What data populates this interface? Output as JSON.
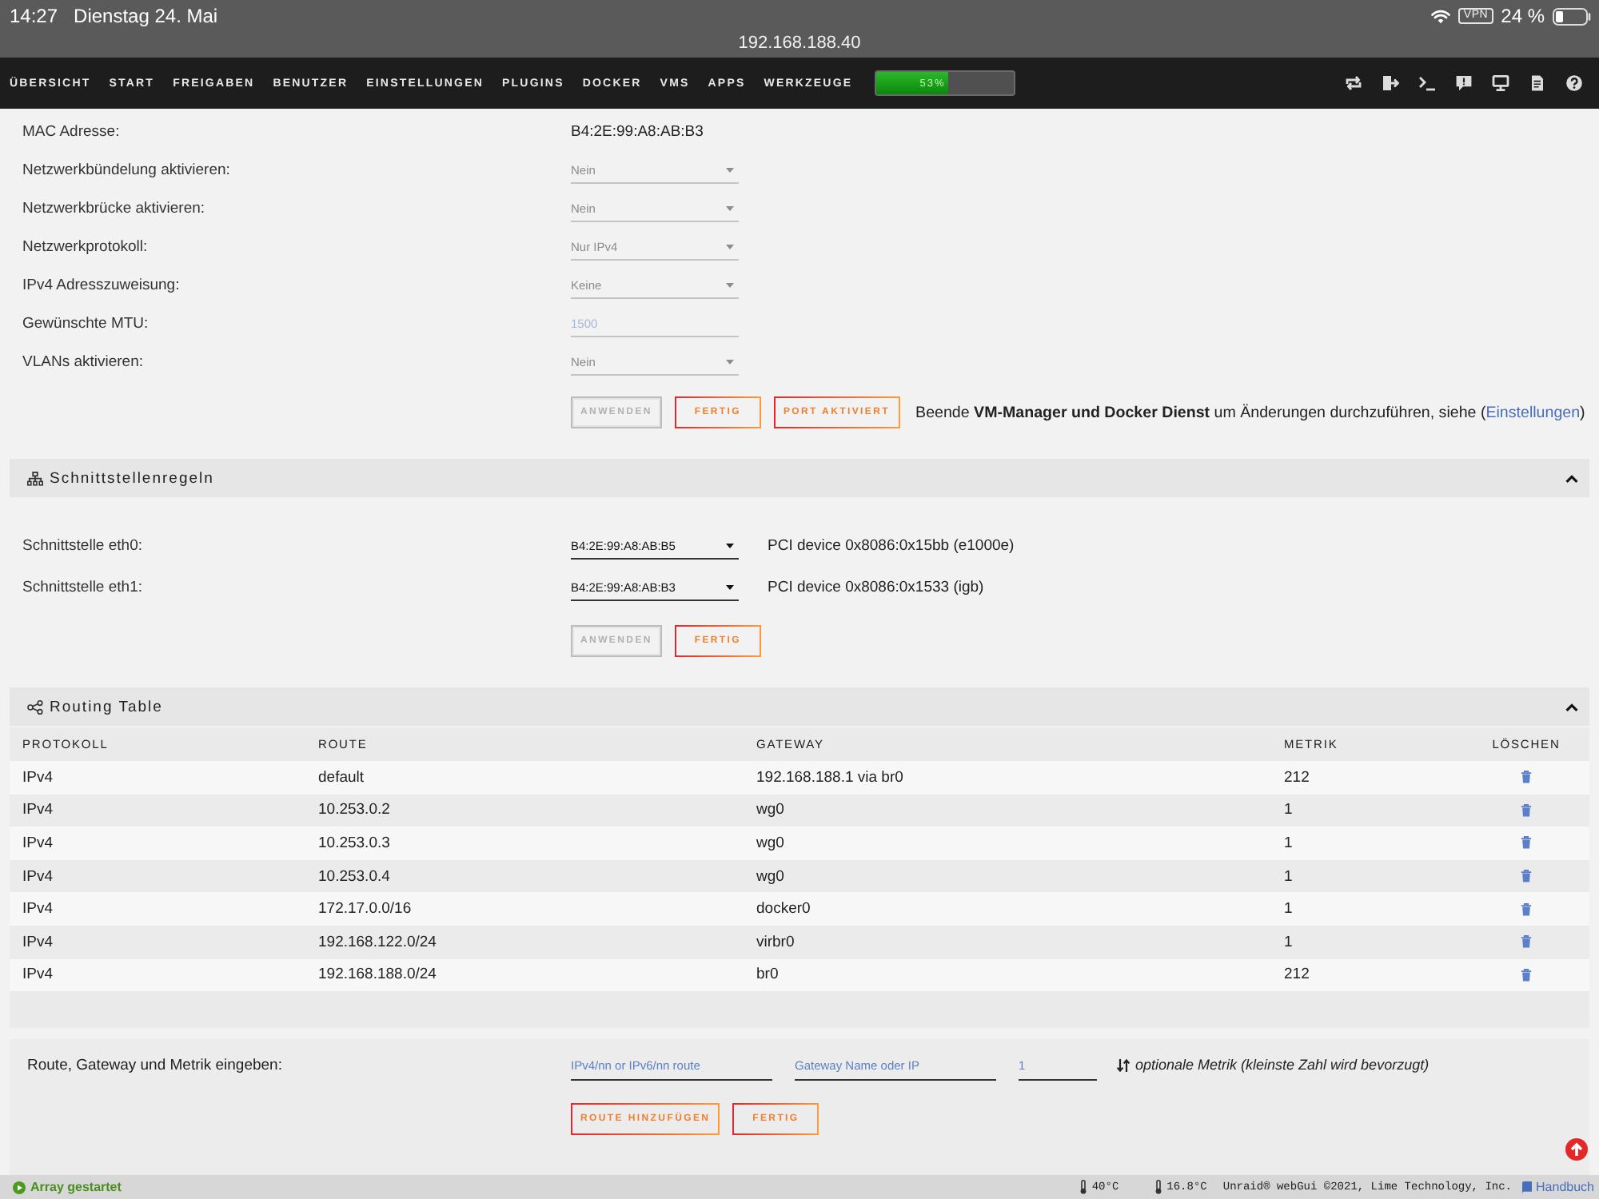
{
  "status_bar": {
    "time": "14:27",
    "date": "Dienstag 24. Mai",
    "url": "192.168.188.40",
    "vpn": "VPN",
    "battery": "24 %"
  },
  "nav": {
    "items": [
      {
        "label": "ÜBERSICHT",
        "selected": false
      },
      {
        "label": "START",
        "selected": false
      },
      {
        "label": "FREIGABEN",
        "selected": false
      },
      {
        "label": "BENUTZER",
        "selected": false
      },
      {
        "label": "EINSTELLUNGEN",
        "selected": false
      },
      {
        "label": "PLUGINS",
        "selected": false
      },
      {
        "label": "DOCKER",
        "selected": false
      },
      {
        "label": "VMS",
        "selected": false
      },
      {
        "label": "APPS",
        "selected": false
      },
      {
        "label": "WERKZEUGE",
        "selected": false
      }
    ],
    "progress": {
      "level": 0.53,
      "reading": "53%"
    }
  },
  "network_settings": {
    "rows": [
      {
        "kind": "text",
        "label": "MAC Adresse:",
        "value": "B4:2E:99:A8:AB:B3"
      },
      {
        "kind": "select",
        "label": "Netzwerkbündelung aktivieren:",
        "value": "Nein",
        "disabled": true
      },
      {
        "kind": "select",
        "label": "Netzwerkbrücke aktivieren:",
        "value": "Nein",
        "disabled": true
      },
      {
        "kind": "select",
        "label": "Netzwerkprotokoll:",
        "value": "Nur IPv4",
        "disabled": true
      },
      {
        "kind": "select",
        "label": "IPv4 Adresszuweisung:",
        "value": "Keine",
        "disabled": true
      },
      {
        "kind": "input",
        "label": "Gewünschte MTU:",
        "placeholder": "1500",
        "disabled": true
      },
      {
        "kind": "select",
        "label": "VLANs aktivieren:",
        "value": "Nein",
        "disabled": true
      }
    ],
    "buttons": [
      {
        "label": "ANWENDEN",
        "disabled": true
      },
      {
        "label": "FERTIG",
        "disabled": false
      },
      {
        "label": "PORT AKTIVIERT",
        "disabled": false
      }
    ],
    "note": {
      "text": "Beende **VM-Manager und Docker Dienst** um Änderungen durchzuführen, siehe (",
      "link": "Einstellungen",
      "text_end": ")"
    }
  },
  "interface_rules": {
    "title": "Schnittstellenregeln",
    "expanded": true,
    "rows": [
      {
        "label": "Schnittstelle eth0:",
        "value": "B4:2E:99:A8:AB:B5",
        "disabled": false,
        "info": "PCI device 0x8086:0x15bb (e1000e)"
      },
      {
        "label": "Schnittstelle eth1:",
        "value": "B4:2E:99:A8:AB:B3",
        "disabled": false,
        "info": "PCI device 0x8086:0x1533 (igb)"
      }
    ],
    "buttons": [
      {
        "label": "ANWENDEN",
        "disabled": true
      },
      {
        "label": "FERTIG",
        "disabled": false
      }
    ]
  },
  "routing_table": {
    "title": "Routing Table",
    "expanded": true,
    "columns": [
      "PROTOKOLL",
      "ROUTE",
      "GATEWAY",
      "METRIK",
      "LÖSCHEN"
    ],
    "rows": [
      [
        "IPv4",
        "default",
        "192.168.188.1 via br0",
        "212"
      ],
      [
        "IPv4",
        "10.253.0.2",
        "wg0",
        "1"
      ],
      [
        "IPv4",
        "10.253.0.3",
        "wg0",
        "1"
      ],
      [
        "IPv4",
        "10.253.0.4",
        "wg0",
        "1"
      ],
      [
        "IPv4",
        "172.17.0.0/16",
        "docker0",
        "1"
      ],
      [
        "IPv4",
        "192.168.122.0/24",
        "virbr0",
        "1"
      ],
      [
        "IPv4",
        "192.168.188.0/24",
        "br0",
        "212"
      ]
    ]
  },
  "add_route": {
    "label": "Route, Gateway und Metrik eingeben:",
    "fields": [
      {
        "placeholder": "IPv4/nn or IPv6/nn route"
      },
      {
        "placeholder": "Gateway Name oder IP"
      },
      {
        "placeholder": "1"
      }
    ],
    "hint": "optionale Metrik (kleinste Zahl wird bevorzugt)",
    "buttons": [
      {
        "label": "ROUTE HINZUFÜGEN",
        "disabled": false
      },
      {
        "label": "FERTIG",
        "disabled": false
      }
    ]
  },
  "footer": {
    "status": "Array gestartet",
    "temperatures": [
      "40°C",
      "16.8°C"
    ],
    "copyright": "Unraid® webGui ©2021, Lime Technology, Inc.",
    "manual_link": "Handbuch"
  }
}
